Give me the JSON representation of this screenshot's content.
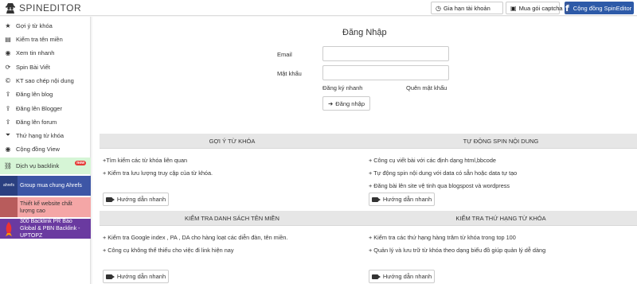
{
  "header": {
    "app_name": "SPINEDITOR",
    "renew_label": "Gia hạn tài khoản",
    "captcha_label": "Mua gói captcha",
    "community_label": "Cộng đồng SpinEditor"
  },
  "sidebar": {
    "items": [
      {
        "label": "Gợi ý từ khóa",
        "icon": "star-icon",
        "glyph": "★"
      },
      {
        "label": "Kiểm tra tên miền",
        "icon": "bars-icon",
        "glyph": "▤"
      },
      {
        "label": "Xem tin nhanh",
        "icon": "eye-icon",
        "glyph": "◉"
      },
      {
        "label": "Spin Bài Viết",
        "icon": "refresh-icon",
        "glyph": "⟳"
      },
      {
        "label": "KT sao chép nội dung",
        "icon": "copyright-icon",
        "glyph": "©"
      },
      {
        "label": "Đăng lên blog",
        "icon": "upload-icon",
        "glyph": "⇪"
      },
      {
        "label": "Đăng lên Blogger",
        "icon": "upload-icon",
        "glyph": "⇪"
      },
      {
        "label": "Đăng lên forum",
        "icon": "upload-icon",
        "glyph": "⇪"
      },
      {
        "label": "Thứ hạng từ khóa",
        "icon": "filter-icon",
        "glyph": "⏷"
      },
      {
        "label": "Cộng đồng View",
        "icon": "eye-icon",
        "glyph": "◉"
      }
    ],
    "backlink": {
      "label": "Dịch vụ backlink",
      "badge": "new"
    },
    "promos": [
      {
        "label": "Group mua chung Ahrefs",
        "thumb": "ahrefs"
      },
      {
        "label": "Thiết kế website chất lượng cao",
        "thumb": ""
      },
      {
        "label": "300 Backlink PR Báo Global & PBN Backlink - UPTOPZ",
        "thumb": ""
      }
    ]
  },
  "login": {
    "title": "Đăng Nhập",
    "email_label": "Email",
    "password_label": "Mật khẩu",
    "register_link": "Đăng ký nhanh",
    "forgot_link": "Quên mật khẩu",
    "submit_label": "Đăng nhập"
  },
  "panels": [
    {
      "title": "GỢI Ý TỪ KHÓA",
      "bullets": [
        "+Tìm kiếm các từ khóa liên quan",
        "+ Kiểm tra lưu lượng truy cập của từ khóa."
      ],
      "guide_label": "Hướng dẫn nhanh"
    },
    {
      "title": "TỰ ĐỘNG SPIN NỘI DUNG",
      "bullets": [
        "+ Công cụ viết bài với các định dạng html,bbcode",
        "+ Tự động spin nội dung với data có sẵn hoặc data tự tạo",
        "+ Đăng bài lên site vệ tinh qua blogspost và wordpress"
      ],
      "guide_label": "Hướng dẫn nhanh"
    },
    {
      "title": "KIỂM TRA DANH SÁCH TÊN MIỀN",
      "bullets": [
        "+ Kiểm tra Google index , PA , DA cho hàng loạt các diễn đàn, tên miền.",
        "+ Công cụ không thể thiếu cho việc đi link hiện nay"
      ],
      "guide_label": "Hướng dẫn nhanh"
    },
    {
      "title": "KIỂM TRA THỨ HẠNG TỪ KHÓA",
      "bullets": [
        "+ Kiểm tra các thứ hạng hàng trăm từ khóa trong top 100",
        "+ Quản lý và lưu trữ từ khóa theo dạng biểu đồ giúp quản lý dễ dàng"
      ],
      "guide_label": "Hướng dẫn nhanh"
    }
  ]
}
